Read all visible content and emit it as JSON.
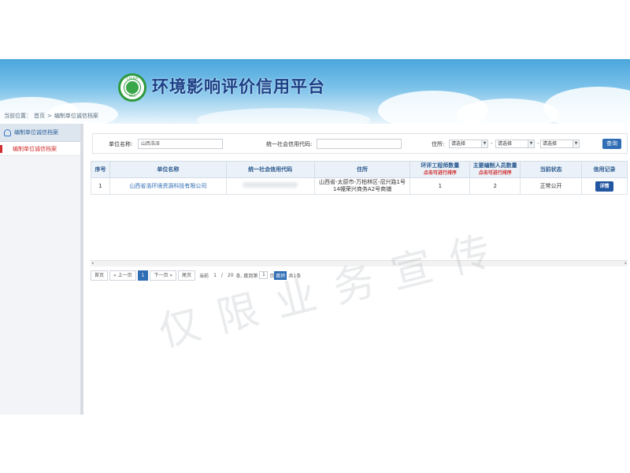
{
  "header": {
    "site_title": "环境影响评价信用平台",
    "logo_top_text": "CHINA",
    "logo_bottom_text": "MEE"
  },
  "breadcrumb": {
    "prefix": "当前位置：",
    "home": "首页",
    "separator": ">",
    "current": "编制单位诚信档案"
  },
  "sidebar": {
    "section_title": "编制单位诚信档案",
    "item_label": "编制单位诚信档案"
  },
  "search": {
    "unit_name_label": "单位名称:",
    "unit_name_value": "山西浩泽",
    "credit_code_label": "统一社会信用代码:",
    "credit_code_value": "",
    "address_label": "住所:",
    "select_1": "请选择",
    "select_2": "请选择",
    "select_3": "请选择",
    "dash": "-",
    "query_button": "查询"
  },
  "table": {
    "headers": {
      "index": "序号",
      "unit_name": "单位名称",
      "credit_code": "统一社会信用代码",
      "address": "住所",
      "engineer_count": "环评工程师数量",
      "engineer_sort_hint": "点击可进行排序",
      "staff_count": "主要编制人员数量",
      "staff_sort_hint": "点击可进行排序",
      "status": "当前状态",
      "credit_record": "信用记录"
    },
    "rows": [
      {
        "index": "1",
        "unit_name": "山西省浩环境资源科技有限公司",
        "address": "山西省-太原市-万柏林区-窊兴路1号14幢荣兴商务A2号商铺",
        "engineer_count": "1",
        "staff_count": "2",
        "status": "正常公开",
        "detail_button": "详情"
      }
    ]
  },
  "scrollbar": {
    "left_arrow": "◂",
    "right_arrow": "▸"
  },
  "pager": {
    "first": "首页",
    "prev": "« 上一页",
    "current_page": "1",
    "next": "下一页 »",
    "last": "尾页",
    "current_label": "当前",
    "page_of": "1",
    "slash": "/",
    "page_size": "20",
    "per_page_unit": "条, 跳到第",
    "jump_value": "1",
    "page_unit": "页",
    "go": "跳转",
    "total": "共1条"
  },
  "watermark": {
    "text": "仅限业务宣传"
  }
}
